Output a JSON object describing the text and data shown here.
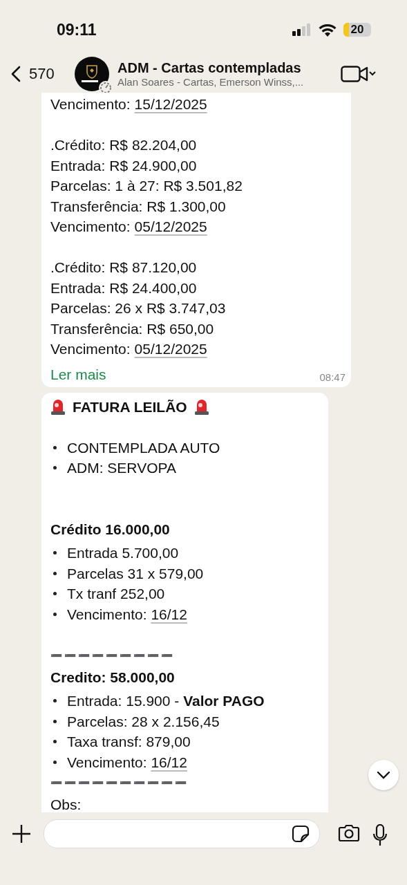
{
  "status_bar": {
    "time": "09:11",
    "battery": "20"
  },
  "header": {
    "back_count": "570",
    "title": "ADM - Cartas contempladas",
    "subtitle": "Alan Soares - Cartas, Emerson Winss,..."
  },
  "messages": [
    {
      "lines": [
        {
          "kind": "date",
          "label": "Vencimento:",
          "date": "15/12/2025"
        },
        {
          "kind": "blank"
        },
        {
          "kind": "text",
          "text": ".Crédito: R$ 82.204,00"
        },
        {
          "kind": "text",
          "text": "Entrada: R$ 24.900,00"
        },
        {
          "kind": "text",
          "text": "Parcelas: 1 à 27: R$ 3.501,82"
        },
        {
          "kind": "text",
          "text": "Transferência: R$ 1.300,00"
        },
        {
          "kind": "date",
          "label": "Vencimento:",
          "date": "05/12/2025"
        },
        {
          "kind": "blank"
        },
        {
          "kind": "text",
          "text": ".Crédito: R$ 87.120,00"
        },
        {
          "kind": "text",
          "text": "Entrada: R$ 24.400,00"
        },
        {
          "kind": "text",
          "text": "Parcelas: 26 x R$ 3.747,03"
        },
        {
          "kind": "text",
          "text": "Transferência: R$ 650,00"
        },
        {
          "kind": "date",
          "label": "Vencimento:",
          "date": "05/12/2025"
        }
      ],
      "read_more": "Ler mais",
      "time": "08:47"
    },
    {
      "lines": [
        {
          "kind": "title",
          "text": "FATURA LEILÃO"
        },
        {
          "kind": "blank"
        },
        {
          "kind": "bullet",
          "text": "CONTEMPLADA AUTO"
        },
        {
          "kind": "bullet",
          "text": "ADM: SERVOPA"
        },
        {
          "kind": "blank"
        },
        {
          "kind": "blank"
        },
        {
          "kind": "bold",
          "text": "Crédito 16.000,00"
        },
        {
          "kind": "bullet",
          "text": "Entrada 5.700,00"
        },
        {
          "kind": "bullet",
          "text": "Parcelas 31 x 579,00"
        },
        {
          "kind": "bullet",
          "text": "Tx tranf 252,00"
        },
        {
          "kind": "bullet-date",
          "label": "Vencimento:",
          "date": "16/12"
        },
        {
          "kind": "blank"
        },
        {
          "kind": "divider",
          "text": "➖➖➖➖➖➖➖➖➖"
        },
        {
          "kind": "bold",
          "text": "Credito: 58.000,00"
        },
        {
          "kind": "bullet",
          "text": "Entrada: 15.900 - **Valor PAGO**"
        },
        {
          "kind": "bullet",
          "text": "Parcelas: 28 x 2.156,45"
        },
        {
          "kind": "bullet",
          "text": "Taxa transf: 879,00"
        },
        {
          "kind": "bullet-date",
          "label": "Vencimento:",
          "date": "16/12"
        },
        {
          "kind": "divider",
          "text": "➖➖➖➖➖➖➖➖➖➖"
        },
        {
          "kind": "text",
          "text": "Obs:"
        }
      ]
    }
  ]
}
